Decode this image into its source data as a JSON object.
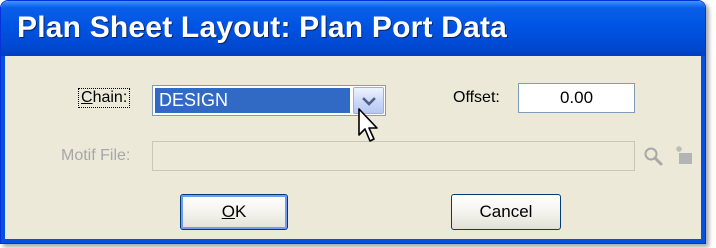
{
  "window": {
    "title": "Plan Sheet Layout: Plan Port Data"
  },
  "chain": {
    "label_mnemonic": "C",
    "label_rest": "hain:",
    "value": "DESIGN"
  },
  "offset": {
    "label": "Offset:",
    "value": "0.00"
  },
  "motif_file": {
    "label": "Motif File:",
    "value": ""
  },
  "buttons": {
    "ok_mnemonic": "O",
    "ok_rest": "K",
    "cancel": "Cancel"
  },
  "icons": {
    "combo": "chevron-down-icon",
    "browse": "magnifier-icon",
    "new": "new-file-icon",
    "cursor": "mouse-pointer-icon"
  },
  "colors": {
    "titlebar": "#0054e3",
    "selection": "#316ac5",
    "dialog_bg": "#ece9d8"
  }
}
